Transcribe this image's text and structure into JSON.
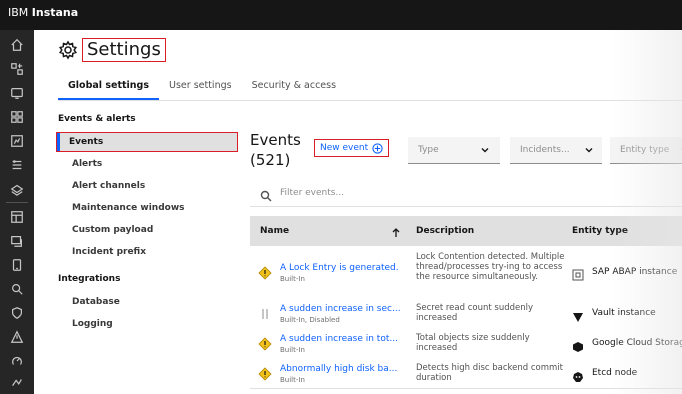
{
  "app": {
    "brand_prefix": "IBM",
    "brand_name": "Instana"
  },
  "page": {
    "title": "Settings"
  },
  "tabs": [
    {
      "label": "Global settings",
      "active": true
    },
    {
      "label": "User settings",
      "active": false
    },
    {
      "label": "Security & access",
      "active": false
    }
  ],
  "sidebar": {
    "group_events": "Events & alerts",
    "events_items": [
      "Events",
      "Alerts",
      "Alert channels",
      "Maintenance windows",
      "Custom payload",
      "Incident prefix"
    ],
    "group_integrations": "Integrations",
    "integration_items": [
      "Database",
      "Logging"
    ]
  },
  "events": {
    "title": "Events",
    "count": "(521)",
    "new_event_label": "New event",
    "filters": {
      "type": "Type",
      "incidents": "Incidents...",
      "entity_type": "Entity type"
    },
    "search_placeholder": "Filter events...",
    "columns": {
      "name": "Name",
      "description": "Description",
      "entity_type": "Entity type"
    },
    "rows": [
      {
        "name": "A Lock Entry is generated.",
        "sub": "Built-In",
        "desc": "Lock Contention detected. Multiple thread/processes try-ing to access the resource simultaneously.",
        "entity": "SAP ABAP instance",
        "status": "built-in"
      },
      {
        "name": "A sudden increase in sec...",
        "sub": "Built-In, Disabled",
        "desc": "Secret read count suddenly increased",
        "entity": "Vault instance",
        "status": "disabled"
      },
      {
        "name": "A sudden increase in tot...",
        "sub": "Built-In",
        "desc": "Total objects size suddenly increased",
        "entity": "Google Cloud Storag",
        "status": "built-in"
      },
      {
        "name": "Abnormally high disk ba...",
        "sub": "Built-In",
        "desc": "Detects high disc backend commit duration",
        "entity": "Etcd node",
        "status": "built-in"
      }
    ]
  },
  "colors": {
    "accent": "#0f62fe",
    "highlight": "#da1e28",
    "warning": "#f1c21b",
    "nav_bg": "#262626",
    "top_bg": "#161616"
  }
}
